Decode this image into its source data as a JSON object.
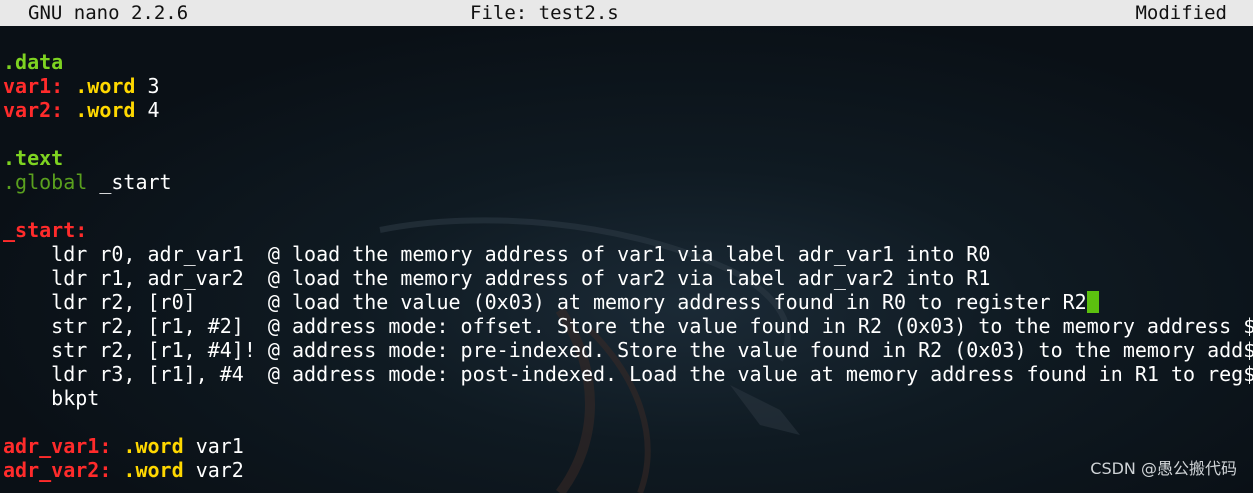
{
  "titlebar": {
    "app": "GNU nano 2.2.6",
    "file": "File: test2.s",
    "status": "Modified"
  },
  "code": {
    "l1": ".data",
    "l2_label": "var1:",
    "l2_dir": ".word",
    "l2_val": "3",
    "l3_label": "var2:",
    "l3_dir": ".word",
    "l3_val": "4",
    "l5": ".text",
    "l6_dir": ".global",
    "l6_val": "_start",
    "l8": "_start:",
    "l9": "    ldr r0, adr_var1  @ load the memory address of var1 via label adr_var1 into R0",
    "l10": "    ldr r1, adr_var2  @ load the memory address of var2 via label adr_var2 into R1",
    "l11": "    ldr r2, [r0]      @ load the value (0x03) at memory address found in R0 to register R2",
    "l12": "    str r2, [r1, #2]  @ address mode: offset. Store the value found in R2 (0x03) to the memory address $",
    "l13": "    str r2, [r1, #4]! @ address mode: pre-indexed. Store the value found in R2 (0x03) to the memory add$",
    "l14": "    ldr r3, [r1], #4  @ address mode: post-indexed. Load the value at memory address found in R1 to reg$",
    "l15": "    bkpt",
    "l17_label": "adr_var1:",
    "l17_dir": ".word",
    "l17_val": "var1",
    "l18_label": "adr_var2:",
    "l18_dir": ".word",
    "l18_val": "var2"
  },
  "watermark": "CSDN @愚公搬代码",
  "colors": {
    "directive": "#7ed321",
    "label": "#ff2b2b",
    "keyword": "#ffd800",
    "cursor": "#5cc00f",
    "background": "#0a1016",
    "titlebar": "#e8e8e8"
  }
}
